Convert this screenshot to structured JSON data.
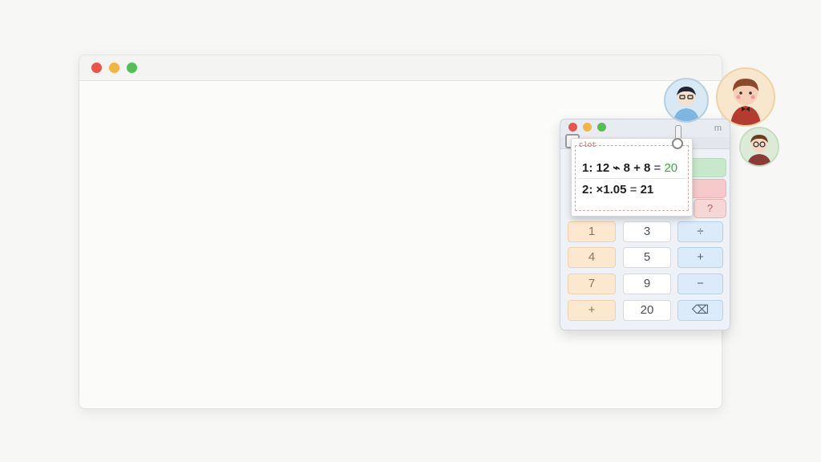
{
  "main_window": {
    "controls": {
      "close": "#e9554a",
      "minimize": "#f1b540",
      "zoom": "#52c054"
    }
  },
  "calculator": {
    "menu_glyph": "m",
    "tape": {
      "label": "clot",
      "lines": [
        {
          "prefix": "1:",
          "expression": "12 ⌁ 8 + 8",
          "equals": "=",
          "result": "20",
          "result_color": "#3aa83e"
        },
        {
          "prefix": "2:",
          "expression": "×1.05",
          "equals": "=",
          "result": "21"
        }
      ]
    },
    "hidden_key": "?",
    "keypad": [
      [
        "1",
        "3",
        "÷"
      ],
      [
        "4",
        "5",
        "+"
      ],
      [
        "7",
        "9",
        "−"
      ],
      [
        "+",
        "20",
        "⌫"
      ]
    ]
  },
  "avatars": [
    "avatar-person-glasses",
    "avatar-person-bowtie",
    "avatar-person-nerd"
  ]
}
